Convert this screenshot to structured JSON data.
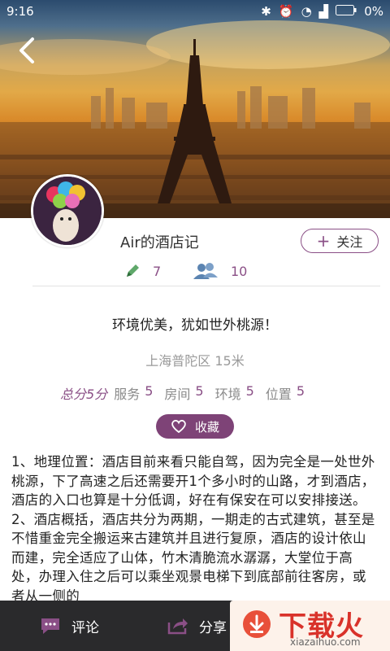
{
  "status_bar": {
    "time": "9:16",
    "battery": "0%"
  },
  "profile": {
    "username": "Air的酒店记",
    "follow_label": "关注",
    "posts": "7",
    "followers": "10"
  },
  "review": {
    "title": "环境优美，犹如世外桃源！",
    "location": "上海普陀区 15米",
    "scores": {
      "total": "总分5分",
      "items": [
        {
          "label": "服务",
          "value": "5"
        },
        {
          "label": "房间",
          "value": "5"
        },
        {
          "label": "环境",
          "value": "5"
        },
        {
          "label": "位置",
          "value": "5"
        }
      ]
    },
    "favorite_label": "收藏",
    "body": "1、地理位置：酒店目前来看只能自驾，因为完全是一处世外桃源，下了高速之后还需要开1个多小时的山路，才到酒店，酒店的入口也算是十分低调，好在有保安在可以安排接送。 2、酒店概括，酒店共分为两期，一期走的古式建筑，甚至是不惜重金完全搬运来古建筑并且进行复原，酒店的设计依山而建，完全适应了山体，竹木清脆流水潺潺，大堂位于高处，办理入住之后可以乘坐观景电梯下到底部前往客房，或者从一侧的"
  },
  "bottom_bar": {
    "comment_label": "评论",
    "share_label": "分享"
  },
  "watermark": {
    "main": "下载火",
    "sub": "xiazaihuo.com"
  },
  "colors": {
    "accent": "#7e4377",
    "bottom_bar": "#2a2a2c"
  }
}
